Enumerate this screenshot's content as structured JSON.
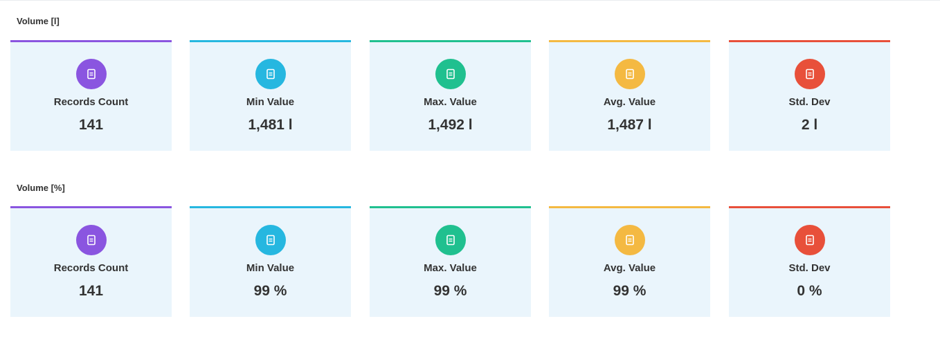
{
  "sections": [
    {
      "title": "Volume [l]",
      "cards": [
        {
          "label": "Records Count",
          "value": "141",
          "color": "#8a55e0",
          "icon": "document-icon"
        },
        {
          "label": "Min Value",
          "value": "1,481 l",
          "color": "#26b7e0",
          "icon": "document-icon"
        },
        {
          "label": "Max. Value",
          "value": "1,492 l",
          "color": "#20c08f",
          "icon": "document-icon"
        },
        {
          "label": "Avg. Value",
          "value": "1,487 l",
          "color": "#f4b942",
          "icon": "document-icon"
        },
        {
          "label": "Std. Dev",
          "value": "2 l",
          "color": "#e8503a",
          "icon": "document-icon"
        }
      ]
    },
    {
      "title": "Volume [%]",
      "cards": [
        {
          "label": "Records Count",
          "value": "141",
          "color": "#8a55e0",
          "icon": "document-icon"
        },
        {
          "label": "Min Value",
          "value": "99 %",
          "color": "#26b7e0",
          "icon": "document-icon"
        },
        {
          "label": "Max. Value",
          "value": "99 %",
          "color": "#20c08f",
          "icon": "document-icon"
        },
        {
          "label": "Avg. Value",
          "value": "99 %",
          "color": "#f4b942",
          "icon": "document-icon"
        },
        {
          "label": "Std. Dev",
          "value": "0 %",
          "color": "#e8503a",
          "icon": "document-icon"
        }
      ]
    }
  ]
}
